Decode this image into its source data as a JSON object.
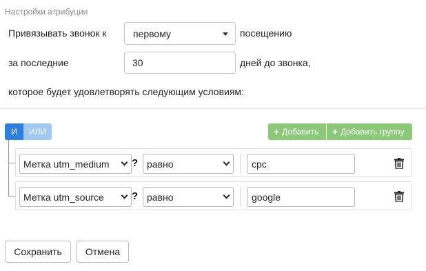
{
  "section_title": "Настройки атрибуции",
  "bind_row": {
    "label": "Привязывать звонок к",
    "selected": "первому",
    "suffix": "посещению"
  },
  "period_row": {
    "label": "за последние",
    "value": "30",
    "suffix": "дней до звонка,"
  },
  "conditions_label": "которое будет удовлетворять следующим условиям:",
  "logic": {
    "and": "И",
    "or": "ИЛИ"
  },
  "actions": {
    "add": "Добавить",
    "add_group": "Добавить группу"
  },
  "rules": [
    {
      "field": "Метка utm_medium",
      "qualifier": "?",
      "operator": "равно",
      "value": "cpc"
    },
    {
      "field": "Метка utm_source",
      "qualifier": "?",
      "operator": "равно",
      "value": "google"
    }
  ],
  "footer": {
    "save": "Сохранить",
    "cancel": "Отмена"
  },
  "colors": {
    "accent_blue": "#2f7fe0",
    "light_blue": "#9fc8f2",
    "green": "#8bc878"
  }
}
